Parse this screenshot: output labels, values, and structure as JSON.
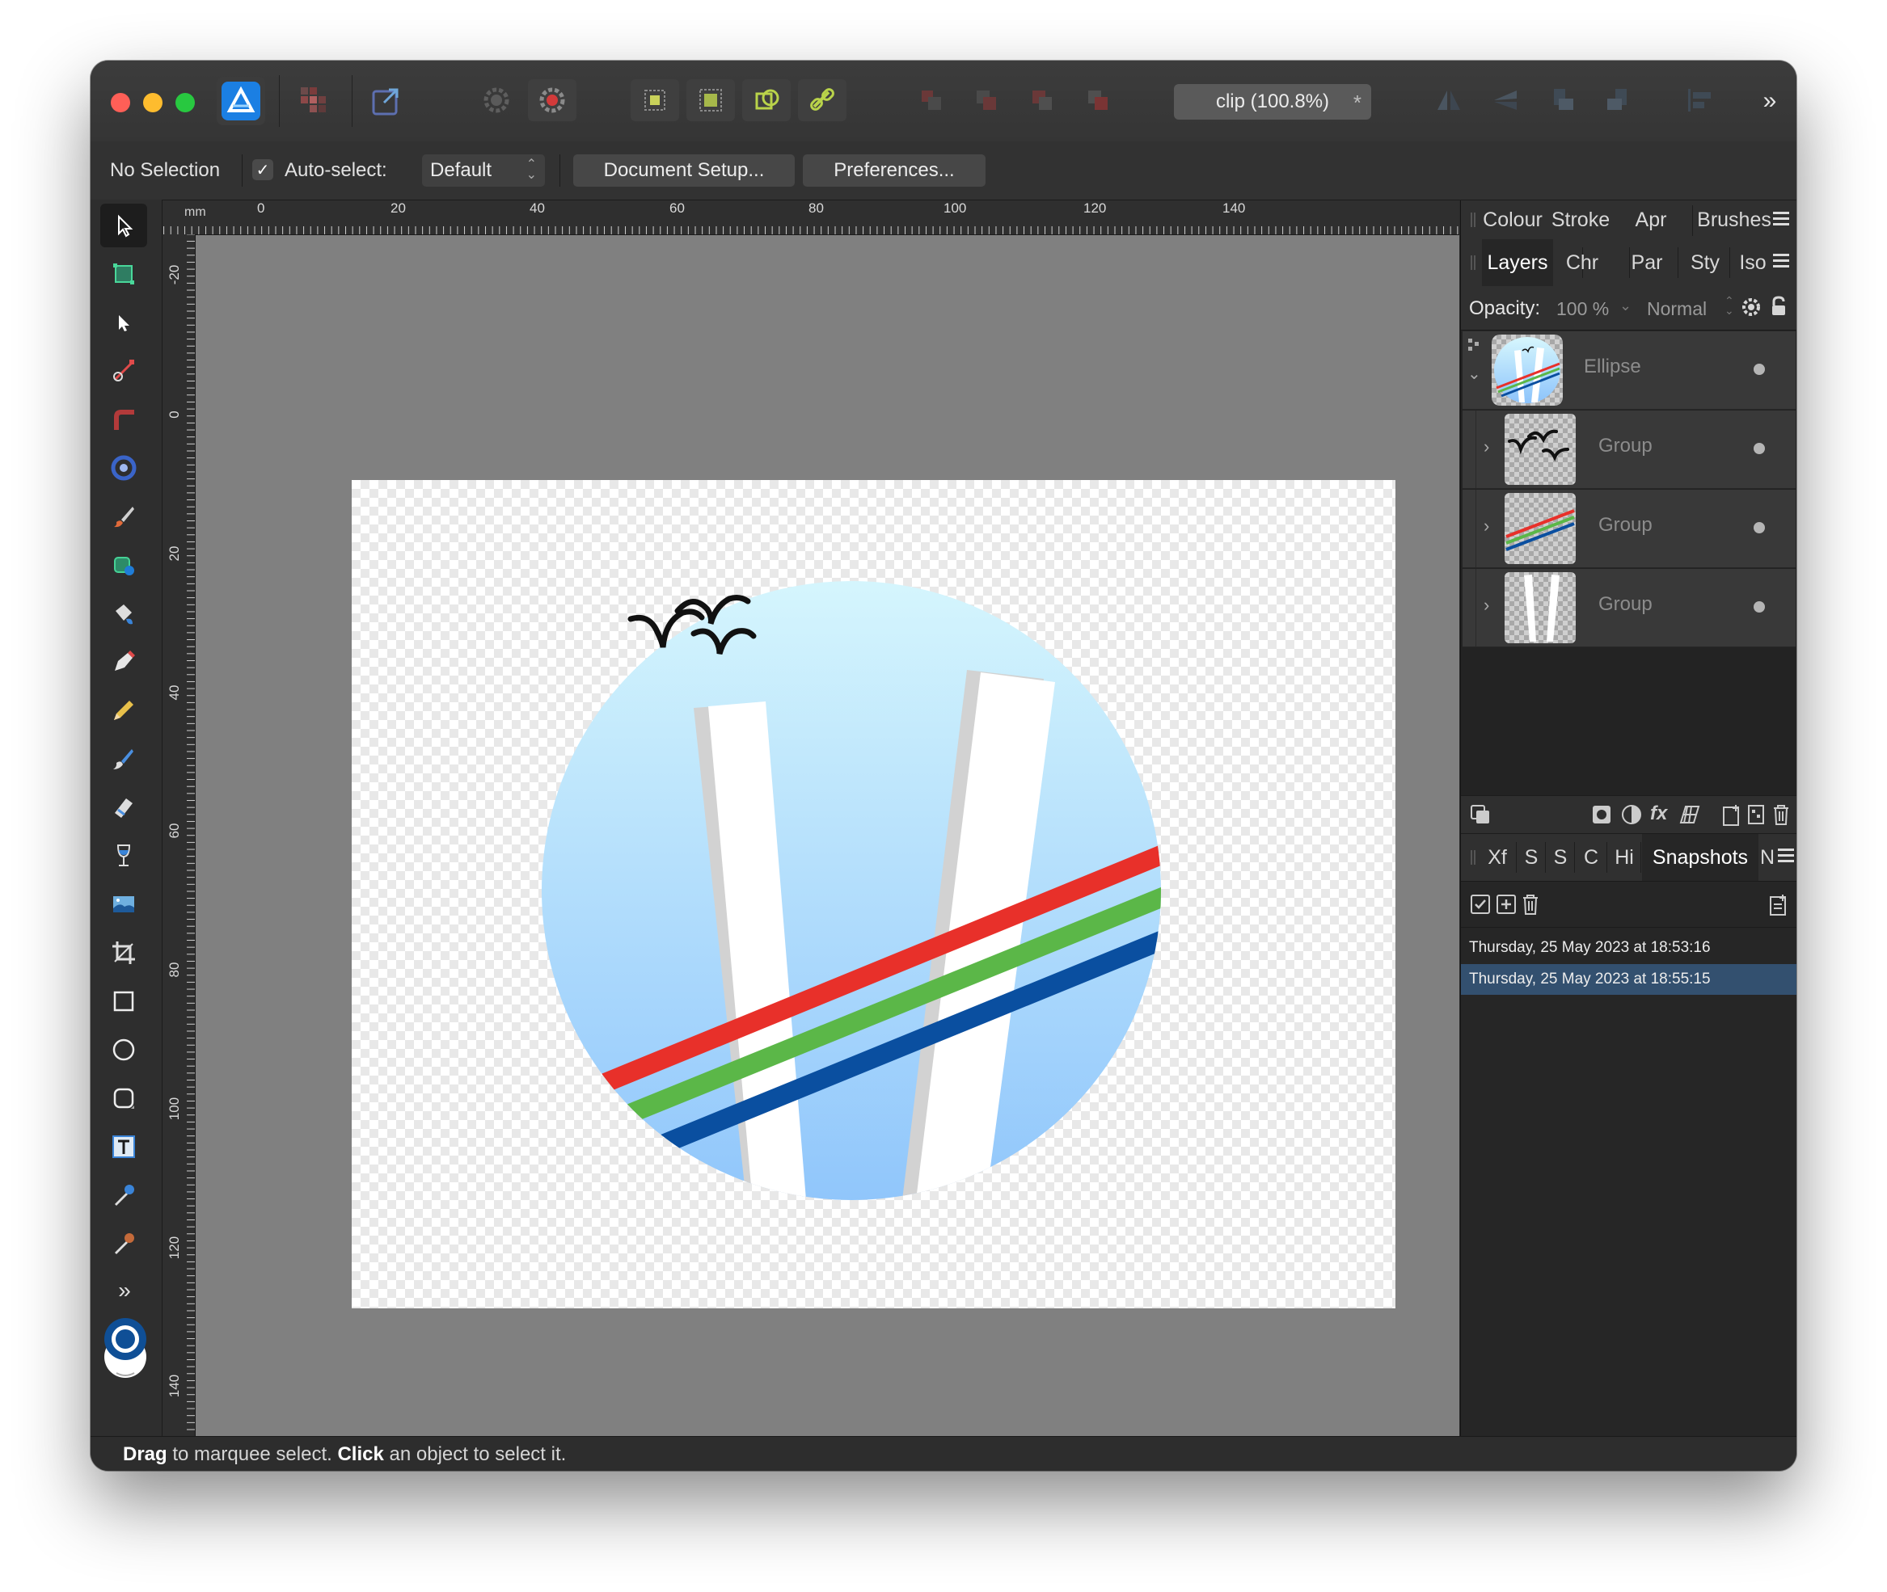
{
  "document_tab": {
    "title": "clip (100.8%)",
    "close_glyph": "*"
  },
  "context_bar": {
    "selection_status": "No Selection",
    "auto_select_label": "Auto-select:",
    "auto_select_checked": true,
    "auto_select_mode": "Default",
    "document_setup_label": "Document Setup...",
    "preferences_label": "Preferences..."
  },
  "ruler": {
    "unit": "mm",
    "top_labels": [
      "0",
      "20",
      "40",
      "60",
      "80",
      "100",
      "120",
      "140"
    ],
    "left_labels": [
      "-20",
      "0",
      "20",
      "40",
      "60",
      "80",
      "100",
      "120",
      "140"
    ]
  },
  "panels": {
    "top_tabs": [
      "Colour",
      "Stroke",
      "Apr",
      "Brushes"
    ],
    "layer_tabs": [
      "Layers",
      "Chr",
      "Par",
      "Sty",
      "Iso"
    ],
    "active_layer_tab": "Layers",
    "opacity_label": "Opacity:",
    "opacity_value": "100 %",
    "blend_mode": "Normal",
    "layers": [
      {
        "name": "Ellipse",
        "visible": true
      },
      {
        "name": "Group",
        "visible": true
      },
      {
        "name": "Group",
        "visible": true
      },
      {
        "name": "Group",
        "visible": true
      }
    ],
    "bottom_tabs": [
      "Xf",
      "S",
      "S",
      "C",
      "Hi",
      "Snapshots",
      "N"
    ],
    "active_bottom_tab": "Snapshots",
    "snapshots": [
      {
        "label": "Thursday, 25 May 2023 at 18:53:16",
        "selected": false
      },
      {
        "label": "Thursday, 25 May 2023 at 18:55:15",
        "selected": true
      }
    ]
  },
  "status_bar": {
    "drag_word": "Drag",
    "drag_text": " to marquee select. ",
    "click_word": "Click",
    "click_text": " an object to select it."
  },
  "colors": {
    "accent_blue": "#1a82f0",
    "stripe_red": "#e8302a",
    "stripe_green": "#5bb748",
    "stripe_blue": "#0a4fa0",
    "selection_highlight": "#33506f"
  },
  "icons": {
    "app": "affinity-designer-icon",
    "tools": [
      "move-tool-icon",
      "artboard-tool-icon",
      "node-tool-icon",
      "corner-tool-icon",
      "pencil-curve-icon",
      "gradient-ring-icon",
      "brush-icon",
      "fill-icon",
      "paint-bucket-icon",
      "pen-tool-icon",
      "pencil-tool-icon",
      "vector-brush-icon",
      "eraser-icon",
      "wine-glass-icon",
      "image-place-icon",
      "crop-tool-icon",
      "rectangle-tool-icon",
      "ellipse-tool-icon",
      "rounded-rect-tool-icon",
      "text-tool-icon",
      "eyedropper-icon",
      "color-picker-icon"
    ]
  }
}
